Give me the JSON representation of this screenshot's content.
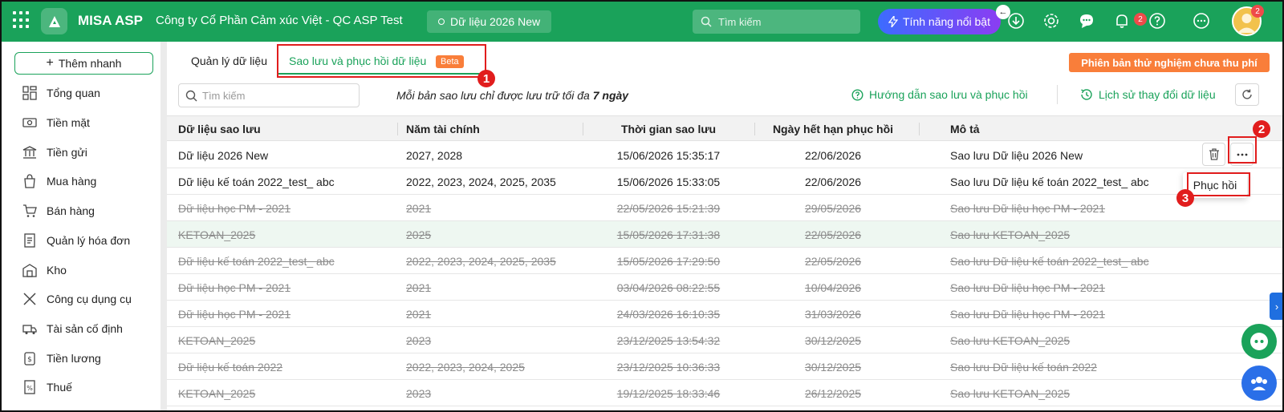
{
  "topbar": {
    "brand": "MISA ASP",
    "company": "Công ty Cổ Phần Cảm xúc Việt - QC ASP Test",
    "database": "Dữ liệu 2026 New",
    "search_placeholder": "Tìm kiếm",
    "feature_label": "Tính năng nổi bật",
    "notification_count": "2",
    "avatar_count": "2"
  },
  "sidebar": {
    "quick_add": "Thêm nhanh",
    "items": [
      {
        "label": "Tổng quan",
        "icon": "dashboard-icon"
      },
      {
        "label": "Tiền mặt",
        "icon": "cash-icon"
      },
      {
        "label": "Tiền gửi",
        "icon": "bank-icon"
      },
      {
        "label": "Mua hàng",
        "icon": "shopping-bag-icon"
      },
      {
        "label": "Bán hàng",
        "icon": "cart-icon"
      },
      {
        "label": "Quản lý hóa đơn",
        "icon": "invoice-icon"
      },
      {
        "label": "Kho",
        "icon": "warehouse-icon"
      },
      {
        "label": "Công cụ dụng cụ",
        "icon": "tools-icon"
      },
      {
        "label": "Tài sản cố định",
        "icon": "truck-icon"
      },
      {
        "label": "Tiền lương",
        "icon": "salary-icon"
      },
      {
        "label": "Thuế",
        "icon": "tax-icon"
      }
    ]
  },
  "tabs": {
    "manage": "Quản lý dữ liệu",
    "backup": "Sao lưu và phục hồi dữ liệu",
    "beta": "Beta"
  },
  "trial_label": "Phiên bản thử nghiệm chưa thu phí",
  "toolbar": {
    "search_placeholder": "Tìm kiếm",
    "note_prefix": "Mỗi bản sao lưu chỉ được lưu trữ tối đa",
    "note_days": "7 ngày",
    "guide_link": "Hướng dẫn sao lưu và phục hồi",
    "history_link": "Lịch sử thay đổi dữ liệu"
  },
  "table": {
    "headers": [
      "Dữ liệu sao lưu",
      "Năm tài chính",
      "Thời gian sao lưu",
      "Ngày hết hạn phục hồi",
      "Mô tả"
    ],
    "rows": [
      [
        "Dữ liệu 2026 New",
        "2027, 2028",
        "15/06/2026 15:35:17",
        "22/06/2026",
        "Sao lưu Dữ liệu 2026 New"
      ],
      [
        "Dữ liệu kế toán 2022_test_ abc",
        "2022, 2023, 2024, 2025, 2035",
        "15/06/2026 15:33:05",
        "22/06/2026",
        "Sao lưu Dữ liệu kế toán 2022_test_ abc"
      ],
      [
        "Dữ liệu học PM - 2021",
        "2021",
        "22/05/2026 15:21:39",
        "29/05/2026",
        "Sao lưu Dữ liệu học PM - 2021"
      ],
      [
        "KETOAN_2025",
        "2025",
        "15/05/2026 17:31:38",
        "22/05/2026",
        "Sao lưu KETOAN_2025"
      ],
      [
        "Dữ liệu kế toán 2022_test_ abc",
        "2022, 2023, 2024, 2025, 2035",
        "15/05/2026 17:29:50",
        "22/05/2026",
        "Sao lưu Dữ liệu kế toán 2022_test_ abc"
      ],
      [
        "Dữ liệu học PM - 2021",
        "2021",
        "03/04/2026 08:22:55",
        "10/04/2026",
        "Sao lưu Dữ liệu học PM - 2021"
      ],
      [
        "Dữ liệu học PM - 2021",
        "2021",
        "24/03/2026 16:10:35",
        "31/03/2026",
        "Sao lưu Dữ liệu học PM - 2021"
      ],
      [
        "KETOAN_2025",
        "2023",
        "23/12/2025 13:54:32",
        "30/12/2025",
        "Sao lưu KETOAN_2025"
      ],
      [
        "Dữ liệu kế toán 2022",
        "2022, 2023, 2024, 2025",
        "23/12/2025 10:36:33",
        "30/12/2025",
        "Sao lưu Dữ liệu kế toán 2022"
      ],
      [
        "KETOAN_2025",
        "2023",
        "19/12/2025 18:33:46",
        "26/12/2025",
        "Sao lưu KETOAN_2025"
      ]
    ]
  },
  "menu": {
    "restore": "Phục hồi"
  },
  "callouts": [
    "1",
    "2",
    "3"
  ]
}
